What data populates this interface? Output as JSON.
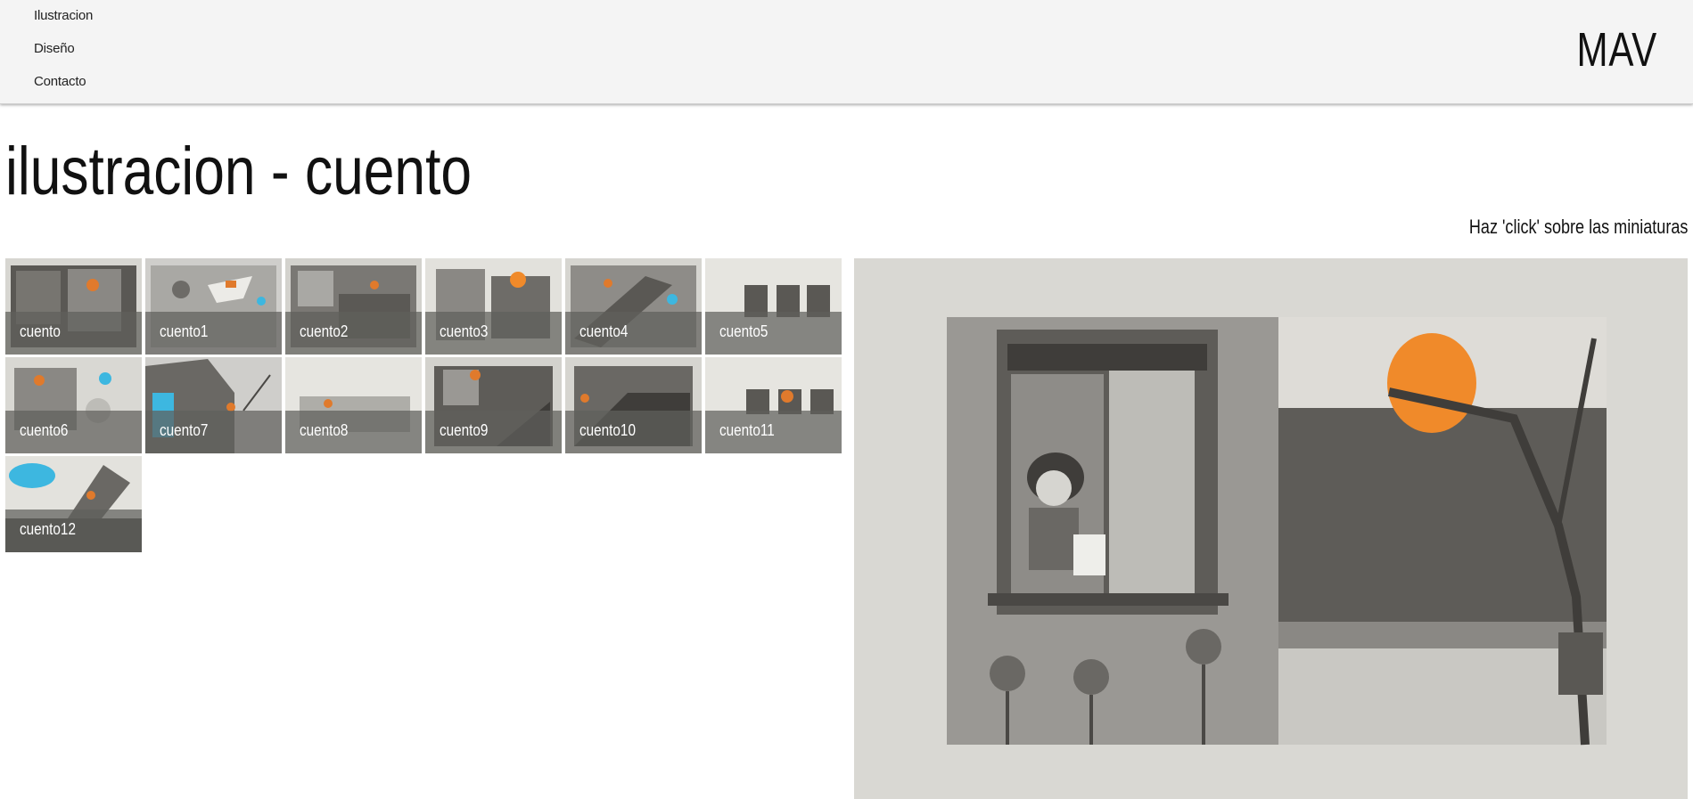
{
  "nav": {
    "items": [
      "Ilustracion",
      "Diseño",
      "Contacto"
    ]
  },
  "brand": {
    "logo": "MAV"
  },
  "page": {
    "title": "ilustracion - cuento",
    "hint": "Haz 'click' sobre las miniaturas"
  },
  "thumbnails": [
    {
      "label": "cuento"
    },
    {
      "label": "cuento1"
    },
    {
      "label": "cuento2"
    },
    {
      "label": "cuento3"
    },
    {
      "label": "cuento4"
    },
    {
      "label": "cuento5"
    },
    {
      "label": "cuento6"
    },
    {
      "label": "cuento7"
    },
    {
      "label": "cuento8"
    },
    {
      "label": "cuento9"
    },
    {
      "label": "cuento10"
    },
    {
      "label": "cuento11"
    },
    {
      "label": "cuento12"
    }
  ],
  "colors": {
    "accent_orange": "#f08a2a",
    "accent_cyan": "#3db7e0",
    "paper": "#e7e6e1",
    "ink": "#4a4845"
  }
}
